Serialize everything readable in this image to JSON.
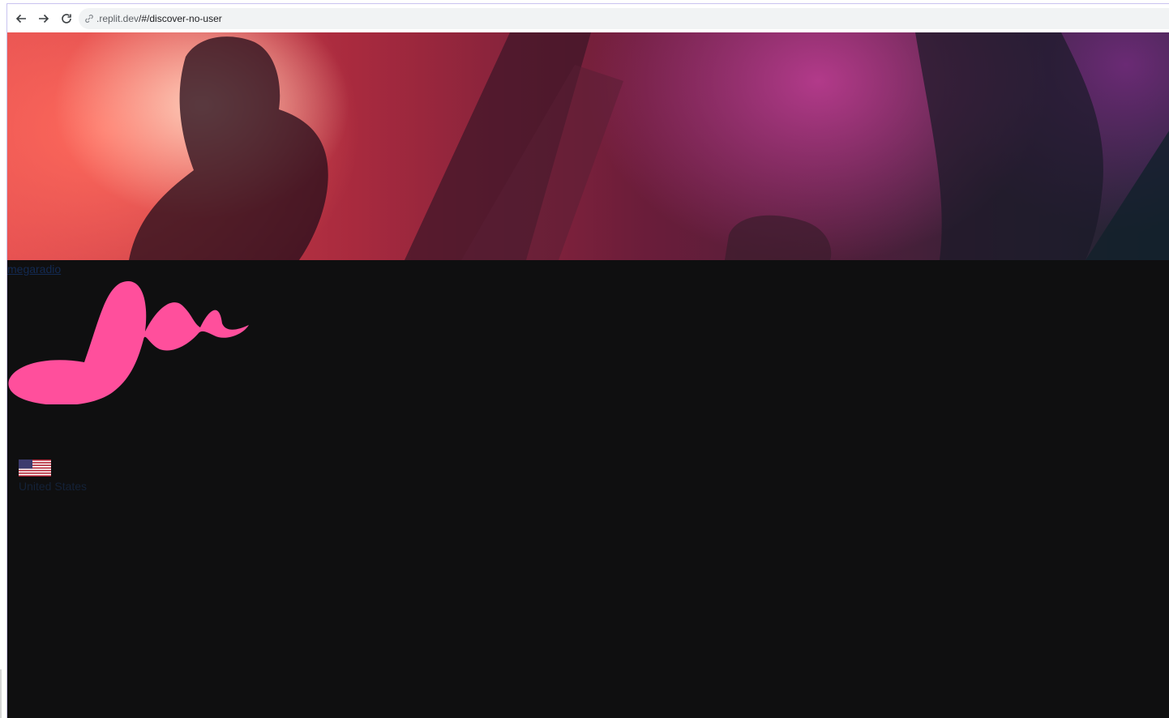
{
  "browser": {
    "url_host": ".replit.dev",
    "url_path": "/#/discover-no-user"
  },
  "profile": {
    "username": "megaradio"
  },
  "location": {
    "country": "United States",
    "flag_icon": "us-flag-icon"
  },
  "colors": {
    "page_background": "#0f0f10",
    "logo_pink": "#ff4f9c",
    "link_dark_blue": "#132a52"
  }
}
